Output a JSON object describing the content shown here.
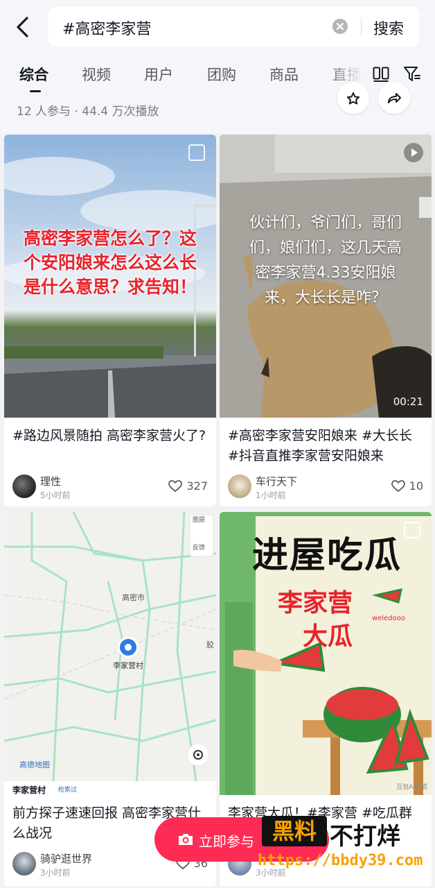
{
  "header": {
    "query": "#高密李家营",
    "search_label": "搜索"
  },
  "tabs": [
    "综合",
    "视频",
    "用户",
    "团购",
    "商品",
    "直播"
  ],
  "stats": "12 人参与 · 44.4 万次播放",
  "cards": [
    {
      "cover_text": "高密李家营怎么了？这个安阳娘来怎么这么长是什么意思？求告知！",
      "desc": "#路边风景随拍 高密李家营火了?",
      "author": "理性",
      "time": "5小时前",
      "likes": "327"
    },
    {
      "cover_text": "伙计们，爷门们，哥们们，娘们们，这几天高密李家营4.33安阳娘来，大长长是咋？",
      "duration": "00:21",
      "desc": "#高密李家营安阳娘来 #大长长 #抖音直推李家营安阳娘来",
      "author": "车行天下",
      "time": "1小时前",
      "likes": "10"
    },
    {
      "map_labels": [
        "高密市",
        "李家营村",
        "胶",
        "高德地图",
        "李家营村",
        "检索过",
        "图层",
        "反馈"
      ],
      "desc": "前方探子速速回报 高密李家营什么战况",
      "author": "骑驴逛世界",
      "time": "3小时前",
      "likes": "36"
    },
    {
      "cover_title": "进屋吃瓜",
      "cover_sub1": "李家营",
      "cover_sub2": "大瓜",
      "cover_tag": "weledooo",
      "cover_corner": "豆包AI生成",
      "desc": "李家营大瓜！#李家营 #吃瓜群",
      "author": "",
      "time": "3小时前",
      "likes": ""
    }
  ],
  "join_button": "立即参与",
  "watermark": {
    "box": "黑料",
    "text": "不打烊",
    "url": "https://bbdy39.com"
  },
  "colors": {
    "accent": "#fe2c55",
    "cover_red": "#e8232b",
    "watermark_orange": "#f6a200"
  }
}
